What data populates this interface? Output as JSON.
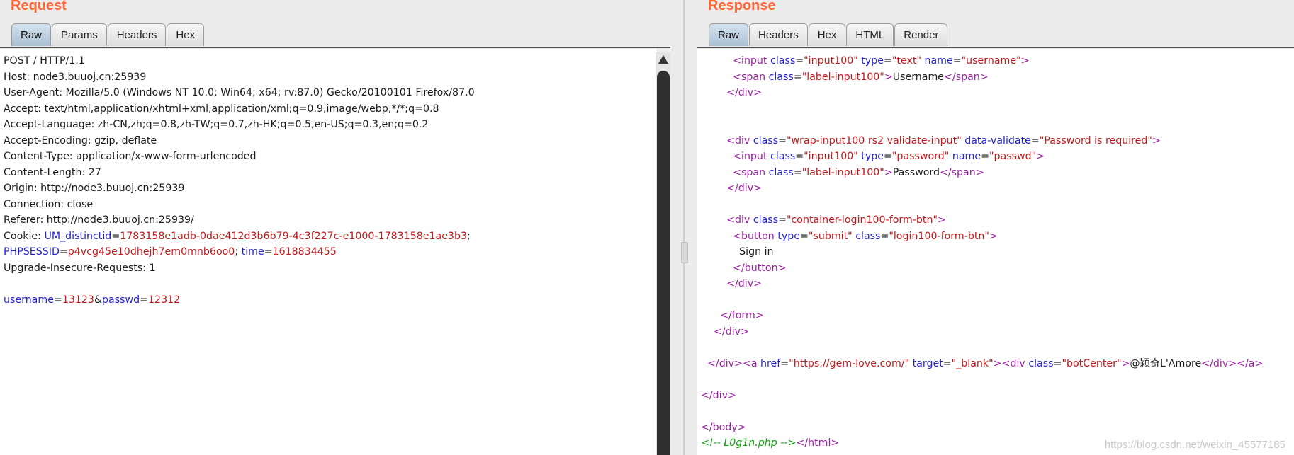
{
  "request": {
    "title": "Request",
    "tabs": [
      "Raw",
      "Params",
      "Headers",
      "Hex"
    ],
    "active_tab": "Raw",
    "lines": [
      "POST / HTTP/1.1",
      "Host: node3.buuoj.cn:25939",
      "User-Agent: Mozilla/5.0 (Windows NT 10.0; Win64; x64; rv:87.0) Gecko/20100101 Firefox/87.0",
      "Accept: text/html,application/xhtml+xml,application/xml;q=0.9,image/webp,*/*;q=0.8",
      "Accept-Language: zh-CN,zh;q=0.8,zh-TW;q=0.7,zh-HK;q=0.5,en-US;q=0.3,en;q=0.2",
      "Accept-Encoding: gzip, deflate",
      "Content-Type: application/x-www-form-urlencoded",
      "Content-Length: 27",
      "Origin: http://node3.buuoj.cn:25939",
      "Connection: close",
      "Referer: http://node3.buuoj.cn:25939/"
    ],
    "cookie_label": "Cookie: ",
    "cookie_um_key": "UM_distinctid",
    "cookie_um_val": "1783158e1adb-0dae412d3b6b79-4c3f227c-e1000-1783158e1ae3b3",
    "cookie_sess_key": "PHPSESSID",
    "cookie_sess_val": "p4vcg45e10dhejh7em0mnb6oo0",
    "cookie_time_key": "time",
    "cookie_time_val": "1618834455",
    "upgrade_line": "Upgrade-Insecure-Requests: 1",
    "body_user_key": "username",
    "body_user_val": "13123",
    "body_pass_key": "passwd",
    "body_pass_val": "12312"
  },
  "response": {
    "title": "Response",
    "tabs": [
      "Raw",
      "Headers",
      "Hex",
      "HTML",
      "Render"
    ],
    "active_tab": "Raw",
    "input_username_type": "text",
    "input_username_name": "username",
    "input_class": "input100",
    "label_class": "label-input100",
    "label_username": "Username",
    "wrap_class": "wrap-input100 rs2 validate-input",
    "wrap_validate": "Password is required",
    "input_password_type": "password",
    "input_password_name": "passwd",
    "label_password": "Password",
    "container_class": "container-login100-form-btn",
    "button_type": "submit",
    "button_class": "login100-form-btn",
    "button_text": "Sign in",
    "link_href": "https://gem-love.com/",
    "link_target": "_blank",
    "link_div_class": "botCenter",
    "link_text": "@颖奇L'Amore",
    "comment": "<!-- L0g1n.php -->"
  },
  "watermark": "https://blog.csdn.net/weixin_45577185"
}
